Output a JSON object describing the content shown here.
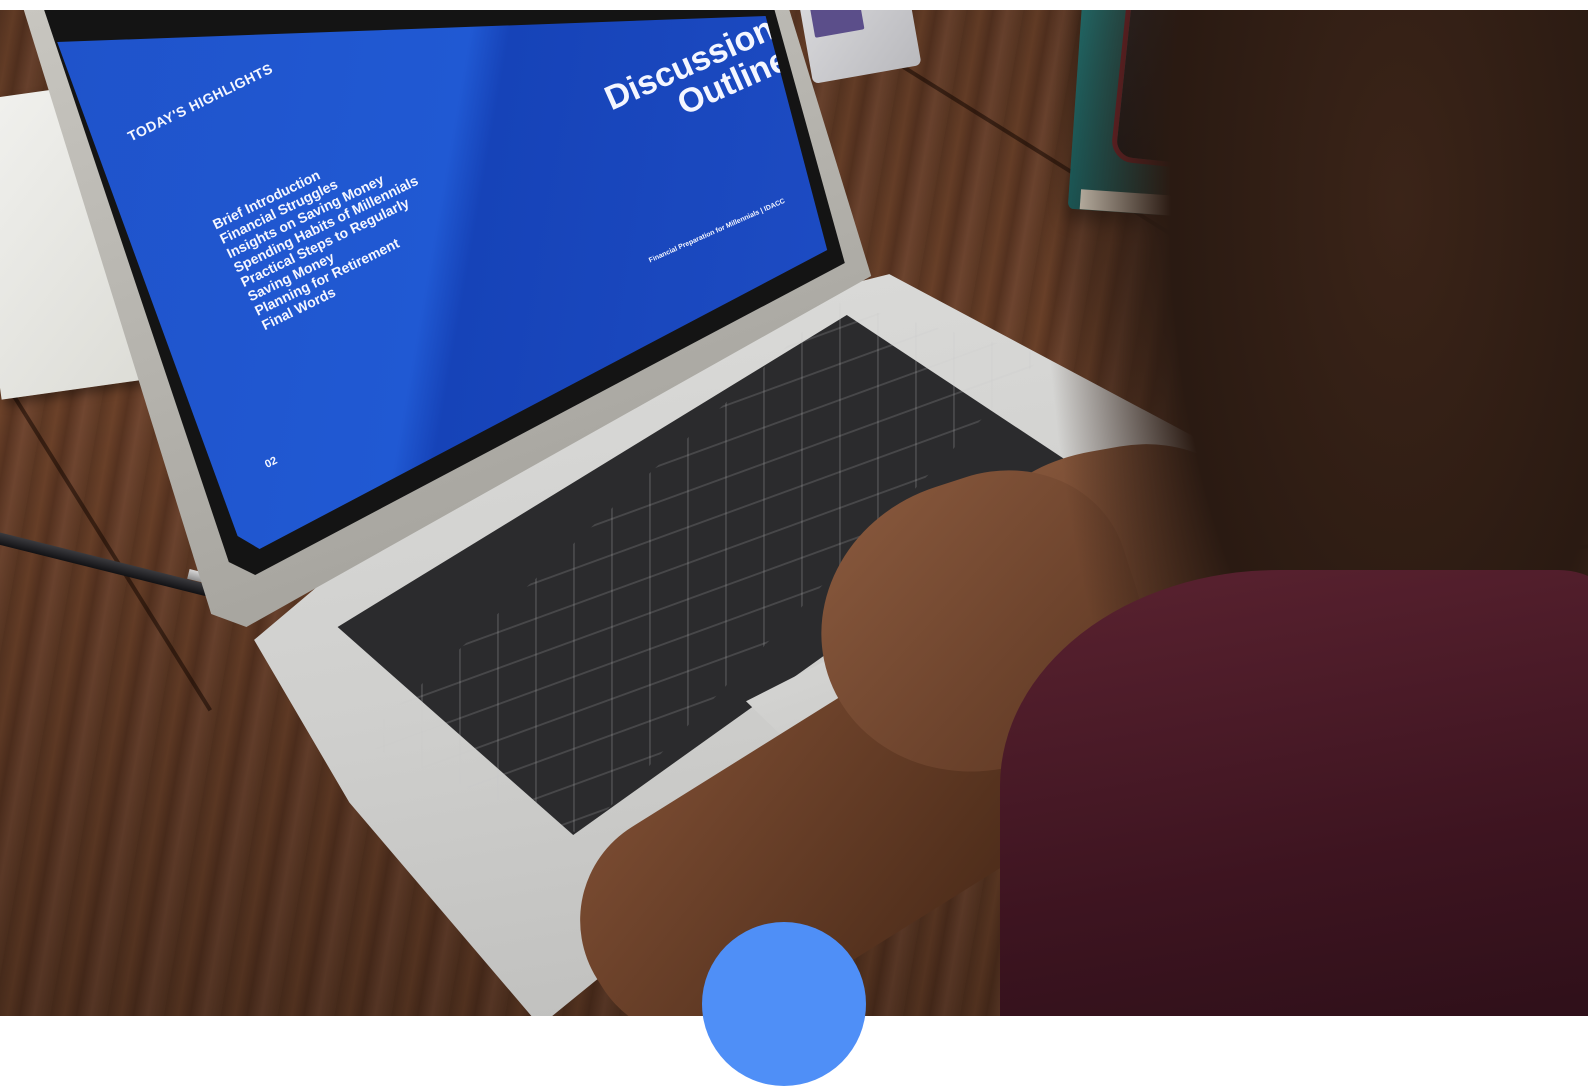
{
  "screen_slide": {
    "left_heading": "TODAY'S HIGHLIGHTS",
    "items": [
      "Brief Introduction",
      "Financial Struggles",
      "Insights on Saving Money",
      "Spending Habits of Millennials",
      "Practical Steps to Regularly",
      "Saving Money",
      "Planning for Retirement",
      "Final Words"
    ],
    "page_number": "02",
    "right_title_line1": "Discussion",
    "right_title_line2": "Outline",
    "footer": "Financial Preparation for Millennials | IDACC"
  },
  "colors": {
    "slide_blue": "#2059d3",
    "accent_circle": "#4f8ff7",
    "table_wood": "#5f3a25"
  }
}
